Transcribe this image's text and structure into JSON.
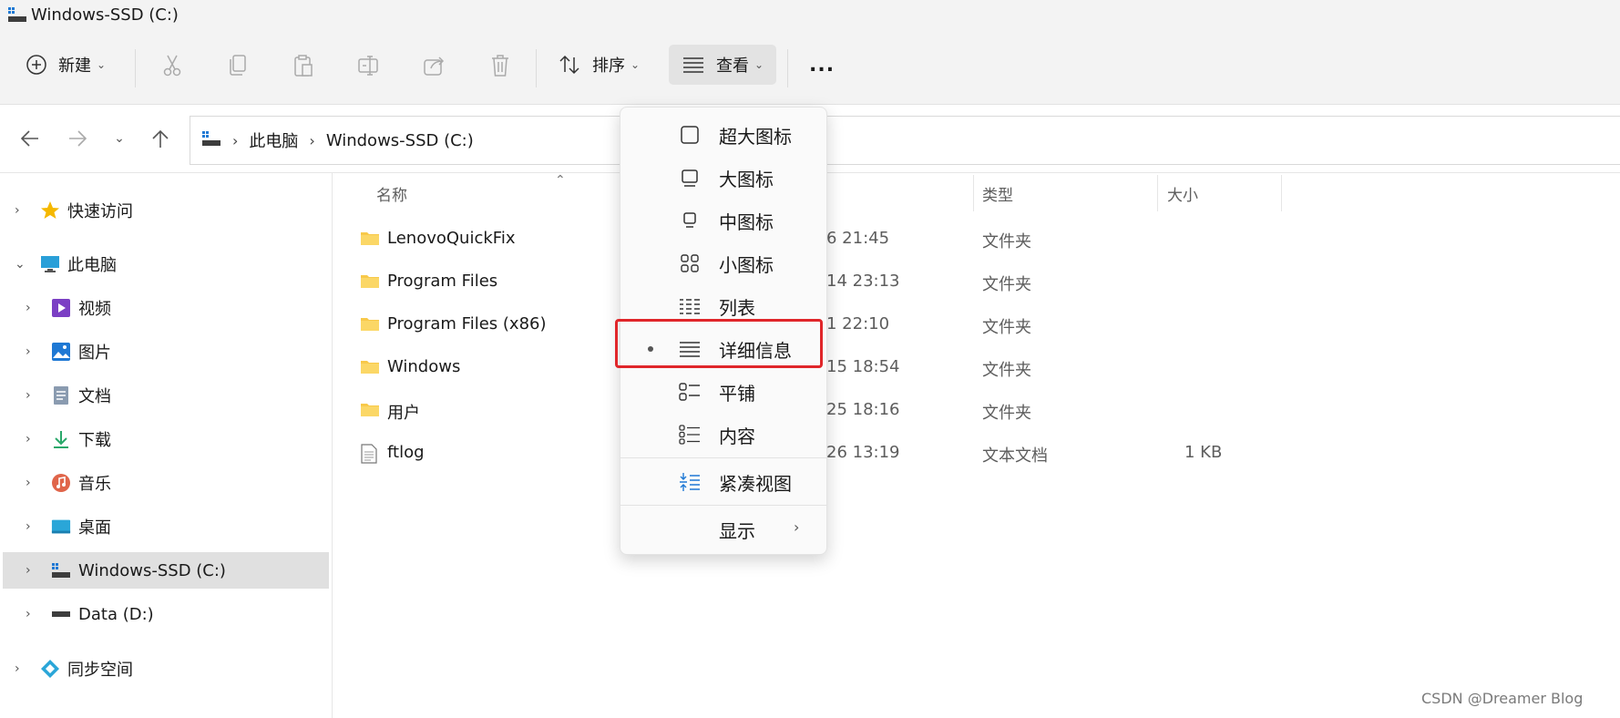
{
  "window": {
    "title": "Windows-SSD (C:)"
  },
  "toolbar": {
    "new_label": "新建",
    "sort_label": "排序",
    "view_label": "查看",
    "more_label": "..."
  },
  "address": {
    "crumbs": [
      "此电脑",
      "Windows-SSD (C:)"
    ]
  },
  "sidebar": {
    "items": [
      {
        "label": "快速访问",
        "icon": "star-icon"
      },
      {
        "label": "此电脑",
        "icon": "monitor-icon"
      },
      {
        "label": "视频",
        "icon": "video-icon"
      },
      {
        "label": "图片",
        "icon": "pictures-icon"
      },
      {
        "label": "文档",
        "icon": "document-icon"
      },
      {
        "label": "下载",
        "icon": "download-icon"
      },
      {
        "label": "音乐",
        "icon": "music-icon"
      },
      {
        "label": "桌面",
        "icon": "desktop-icon"
      },
      {
        "label": "Windows-SSD (C:)",
        "icon": "drive-icon"
      },
      {
        "label": "Data (D:)",
        "icon": "drive-icon"
      },
      {
        "label": "同步空间",
        "icon": "sync-space-icon"
      }
    ]
  },
  "columns": {
    "name": "名称",
    "type": "类型",
    "size": "大小"
  },
  "files": [
    {
      "name": "LenovoQuickFix",
      "date": "6 21:45",
      "type": "文件夹",
      "size": "",
      "kind": "folder"
    },
    {
      "name": "Program Files",
      "date": "14 23:13",
      "type": "文件夹",
      "size": "",
      "kind": "folder"
    },
    {
      "name": "Program Files (x86)",
      "date": "1 22:10",
      "type": "文件夹",
      "size": "",
      "kind": "folder"
    },
    {
      "name": "Windows",
      "date": "15 18:54",
      "type": "文件夹",
      "size": "",
      "kind": "folder"
    },
    {
      "name": "用户",
      "date": "25 18:16",
      "type": "文件夹",
      "size": "",
      "kind": "folder"
    },
    {
      "name": "ftlog",
      "date": "26 13:19",
      "type": "文本文档",
      "size": "1 KB",
      "kind": "text"
    }
  ],
  "view_menu": {
    "items": [
      {
        "label": "超大图标",
        "icon": "extra-large-icons-icon"
      },
      {
        "label": "大图标",
        "icon": "large-icons-icon"
      },
      {
        "label": "中图标",
        "icon": "medium-icons-icon"
      },
      {
        "label": "小图标",
        "icon": "small-icons-icon"
      },
      {
        "label": "列表",
        "icon": "list-icon"
      },
      {
        "label": "详细信息",
        "icon": "details-icon",
        "selected": true
      },
      {
        "label": "平铺",
        "icon": "tiles-icon"
      },
      {
        "label": "内容",
        "icon": "content-icon"
      },
      {
        "label": "紧凑视图",
        "icon": "compact-view-icon"
      },
      {
        "label": "显示",
        "icon": "chevron-right-icon"
      }
    ]
  },
  "watermark": "CSDN @Dreamer Blog",
  "colors": {
    "highlight": "#e0262a",
    "accent": "#0067c0",
    "folder": "#f8c94a"
  }
}
